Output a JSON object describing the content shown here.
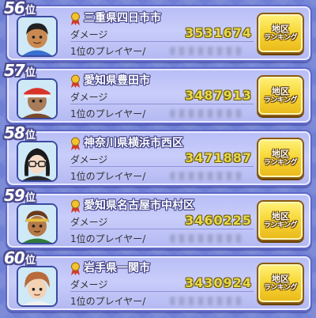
{
  "labels": {
    "rank_suffix": "位",
    "damage_label": "ダメージ",
    "top_player_label": "1位のプレイヤー/",
    "button_line1": "地区",
    "button_line2": "ランキング"
  },
  "rows": [
    {
      "rank": "56",
      "region": "三重県四日市市",
      "damage": "3531674",
      "avatar": "boy-tanned-icon"
    },
    {
      "rank": "57",
      "region": "愛知県豊田市",
      "damage": "3487913",
      "avatar": "old-man-red-hat-icon"
    },
    {
      "rank": "58",
      "region": "神奈川県横浜市西区",
      "damage": "3471887",
      "avatar": "girl-glasses-icon"
    },
    {
      "rank": "59",
      "region": "愛知県名古屋市中村区",
      "damage": "3460225",
      "avatar": "boy-headband-icon"
    },
    {
      "rank": "60",
      "region": "岩手県一関市",
      "damage": "3430924",
      "avatar": "boy-brown-hair-icon"
    }
  ],
  "colors": {
    "background": "#6f7fd4",
    "row_fill": "#c0c5f8",
    "damage_value": "#e8d94a",
    "button": "#f7d533"
  }
}
